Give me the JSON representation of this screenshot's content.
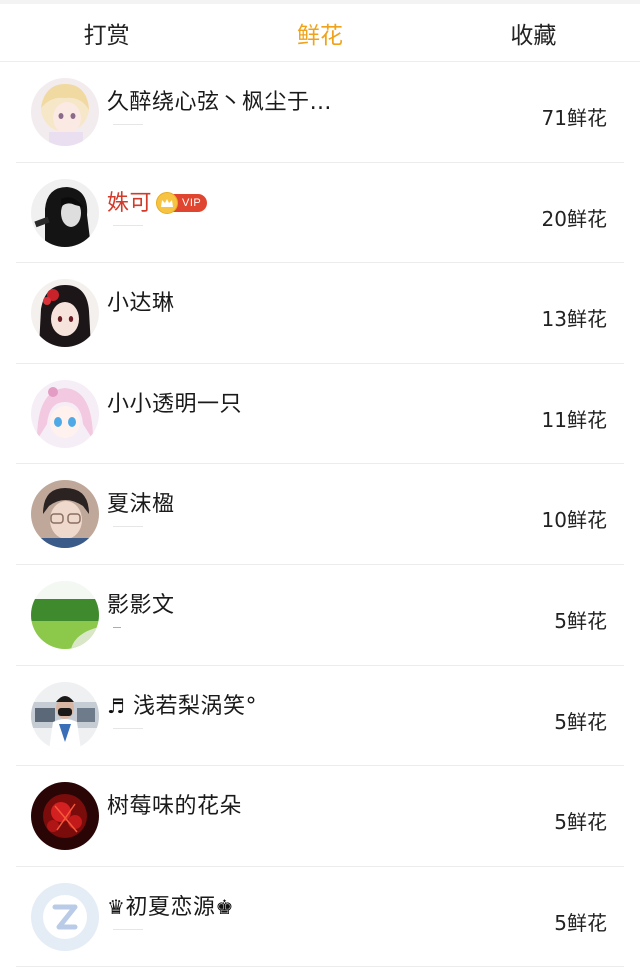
{
  "tabs": [
    {
      "label": "打赏",
      "active": false
    },
    {
      "label": "鲜花",
      "active": true
    },
    {
      "label": "收藏",
      "active": false
    }
  ],
  "accent_color": "#f0a31a",
  "vip_name_color": "#d23a2a",
  "users": [
    {
      "name": "久醉绕心弦丶枫尘于…",
      "count": "71鲜花",
      "avatar": "anime-blonde-avatar"
    },
    {
      "name": "姝可",
      "vip": true,
      "vip_label": "VIP",
      "count": "20鲜花",
      "avatar": "dark-portrait-avatar"
    },
    {
      "name": "小达琳",
      "count": "13鲜花",
      "avatar": "anime-red-flower-avatar"
    },
    {
      "name": "小小透明一只",
      "count": "11鲜花",
      "avatar": "anime-pink-hair-avatar"
    },
    {
      "name": "夏沫楹",
      "count": "10鲜花",
      "avatar": "glasses-portrait-avatar"
    },
    {
      "name": "影影文",
      "count": "5鲜花",
      "avatar": "green-landscape-avatar"
    },
    {
      "name": "浅若梨涡笑°",
      "prefix_glyph": "♬",
      "count": "5鲜花",
      "avatar": "masked-person-avatar"
    },
    {
      "name": "树莓味的花朵",
      "count": "5鲜花",
      "avatar": "red-flowers-avatar"
    },
    {
      "name": "初夏恋源",
      "prefix_glyph": "♛",
      "suffix_glyph": "♚",
      "count": "5鲜花",
      "avatar": "default-z-avatar"
    }
  ]
}
